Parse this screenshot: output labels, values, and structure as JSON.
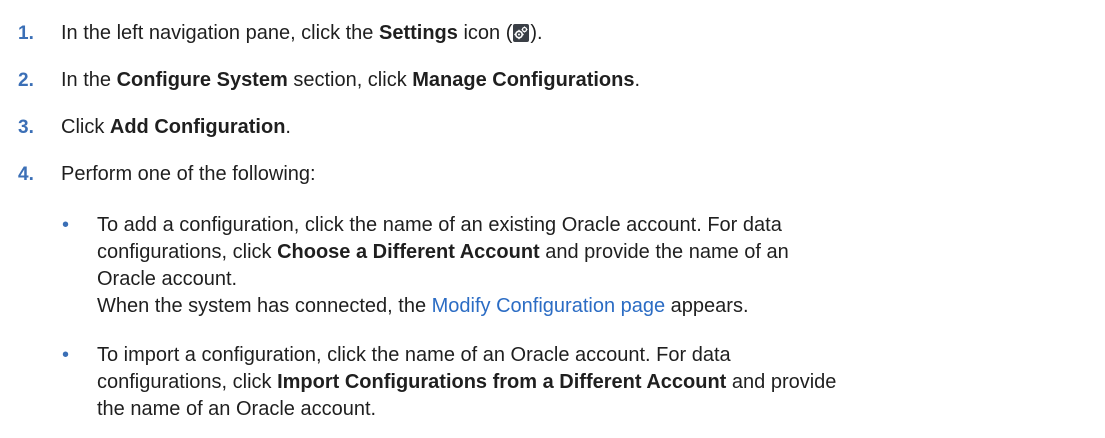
{
  "steps": [
    {
      "num": "1.",
      "pre": "In the left navigation pane, click the ",
      "bold": "Settings",
      "mid": " icon (",
      "icon": "settings-gears-icon",
      "post": ")."
    },
    {
      "num": "2.",
      "pre": "In the ",
      "bold1": "Configure System",
      "mid": " section, click ",
      "bold2": "Manage Configurations",
      "post": "."
    },
    {
      "num": "3.",
      "pre": "Click ",
      "bold": "Add Configuration",
      "post": "."
    },
    {
      "num": "4.",
      "text": "Perform one of the following:"
    }
  ],
  "bullets": [
    {
      "line1": "To add a configuration, click the name of an existing Oracle account. For data",
      "line2_pre": "configurations, click ",
      "line2_bold": "Choose a Different Account",
      "line2_post": " and provide the name of an",
      "line3": "Oracle account.",
      "line4_pre": "When the system has connected, the ",
      "line4_link": "Modify Configuration page",
      "line4_post": " appears."
    },
    {
      "line1": "To import a configuration, click the name of an Oracle account. For data",
      "line2_pre": "configurations, click ",
      "line2_bold": "Import Configurations from a Different Account",
      "line2_post": " and provide",
      "line3": "the name of an Oracle account."
    }
  ],
  "colors": {
    "step_number": "#3b6fb6",
    "link": "#2b6cc4",
    "text": "#1f1f1f"
  },
  "bullet_glyph": "•"
}
